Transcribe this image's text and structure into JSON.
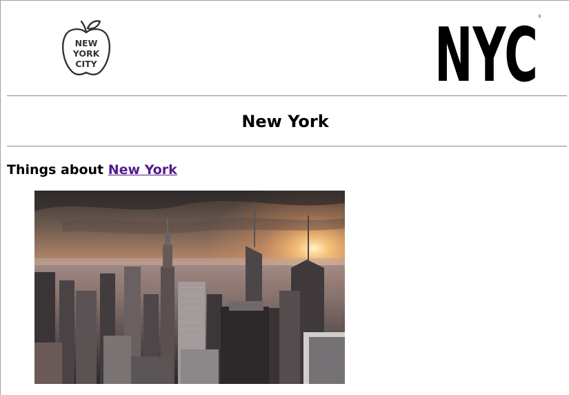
{
  "header": {
    "apple_logo_text": [
      "NEW",
      "YORK",
      "CITY"
    ],
    "nyc_logo_text": "NYC"
  },
  "page": {
    "title": "New York",
    "subheading_prefix": "Things about ",
    "subheading_link": "New York"
  },
  "colors": {
    "visited_link": "#551a8b",
    "rule": "#9a9a9a"
  },
  "image": {
    "subject": "New York City skyline at sunset"
  }
}
